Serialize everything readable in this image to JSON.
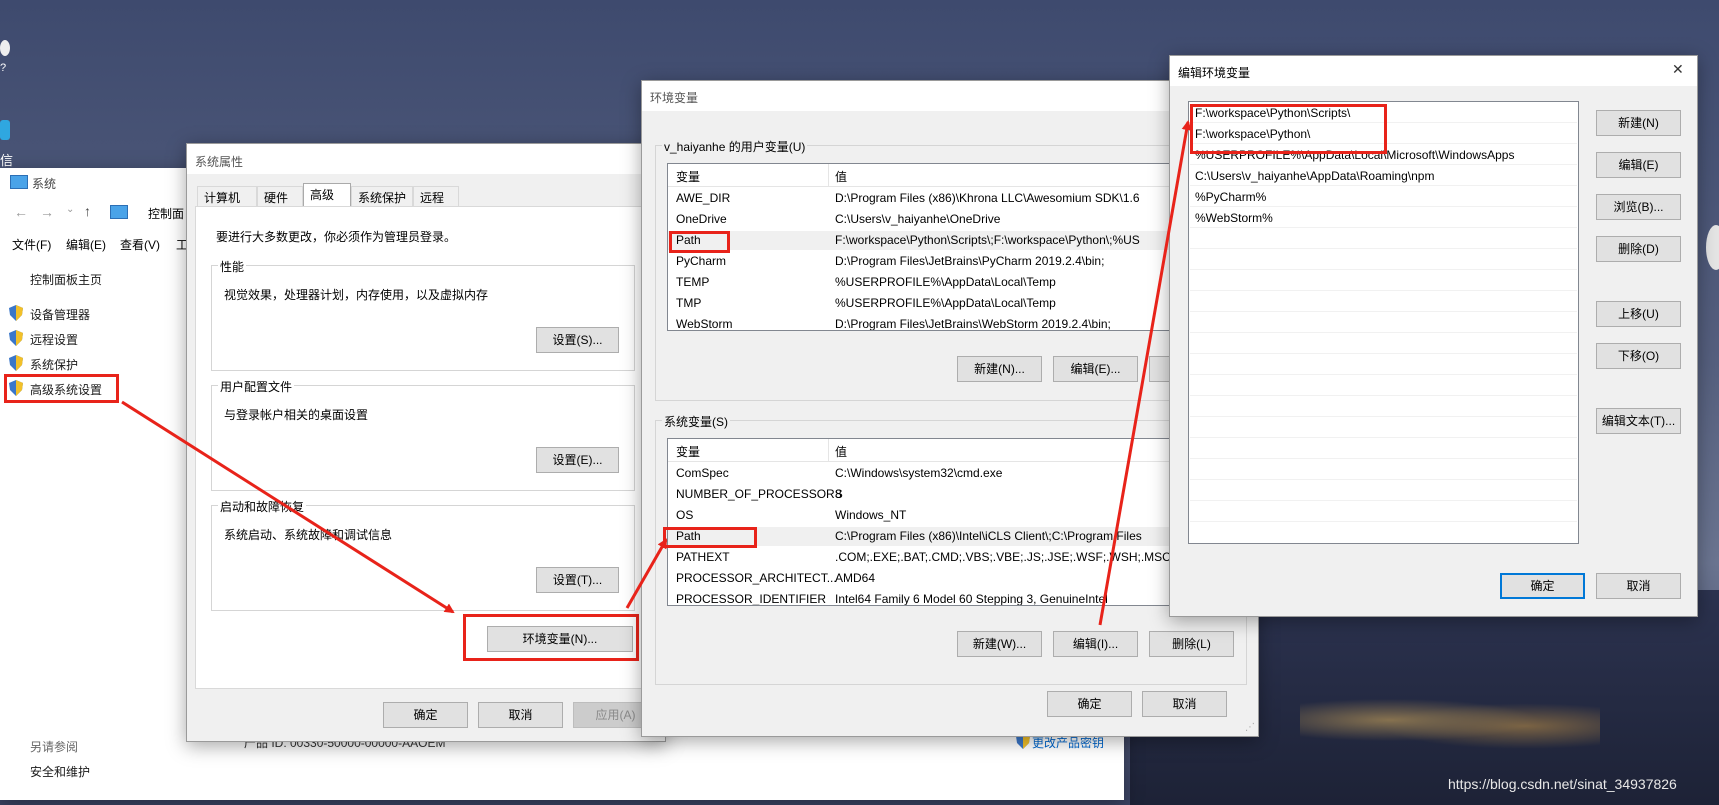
{
  "desktop": {
    "left_icon_label1": "?",
    "left_icon_label2": "信",
    "watermark": "https://blog.csdn.net/sinat_34937826"
  },
  "system_window": {
    "title": "系统",
    "address": "控制面",
    "menu": [
      "文件(F)",
      "编辑(E)",
      "查看(V)",
      "工"
    ],
    "nav_home": "控制面板主页",
    "links": [
      "设备管理器",
      "远程设置",
      "系统保护",
      "高级系统设置"
    ],
    "see_also": "另请参阅",
    "security": "安全和维护",
    "product_id": "产品 ID: 00330-50000-00000-AAOEM",
    "change_key": "更改产品密钥"
  },
  "sysprops": {
    "title": "系统属性",
    "tabs": [
      "计算机名",
      "硬件",
      "高级",
      "系统保护",
      "远程"
    ],
    "admin_note": "要进行大多数更改，你必须作为管理员登录。",
    "perf_label": "性能",
    "perf_desc": "视觉效果，处理器计划，内存使用，以及虚拟内存",
    "perf_btn": "设置(S)...",
    "profile_label": "用户配置文件",
    "profile_desc": "与登录帐户相关的桌面设置",
    "profile_btn": "设置(E)...",
    "startup_label": "启动和故障恢复",
    "startup_desc": "系统启动、系统故障和调试信息",
    "startup_btn": "设置(T)...",
    "env_btn": "环境变量(N)...",
    "ok": "确定",
    "cancel": "取消",
    "apply": "应用(A)"
  },
  "envvars": {
    "title": "环境变量",
    "user_group": "v_haiyanhe 的用户变量(U)",
    "col_var": "变量",
    "col_val": "值",
    "user_vars": [
      {
        "name": "AWE_DIR",
        "value": "D:\\Program Files (x86)\\Khrona LLC\\Awesomium SDK\\1.6"
      },
      {
        "name": "OneDrive",
        "value": "C:\\Users\\v_haiyanhe\\OneDrive"
      },
      {
        "name": "Path",
        "value": "F:\\workspace\\Python\\Scripts\\;F:\\workspace\\Python\\;%US"
      },
      {
        "name": "PyCharm",
        "value": "D:\\Program Files\\JetBrains\\PyCharm 2019.2.4\\bin;"
      },
      {
        "name": "TEMP",
        "value": "%USERPROFILE%\\AppData\\Local\\Temp"
      },
      {
        "name": "TMP",
        "value": "%USERPROFILE%\\AppData\\Local\\Temp"
      },
      {
        "name": "WebStorm",
        "value": "D:\\Program Files\\JetBrains\\WebStorm 2019.2.4\\bin;"
      }
    ],
    "user_new": "新建(N)...",
    "user_edit": "编辑(E)...",
    "sys_group": "系统变量(S)",
    "sys_vars": [
      {
        "name": "ComSpec",
        "value": "C:\\Windows\\system32\\cmd.exe"
      },
      {
        "name": "NUMBER_OF_PROCESSORS",
        "value": "8"
      },
      {
        "name": "OS",
        "value": "Windows_NT"
      },
      {
        "name": "Path",
        "value": "C:\\Program Files (x86)\\Intel\\iCLS Client\\;C:\\Program Files"
      },
      {
        "name": "PATHEXT",
        "value": ".COM;.EXE;.BAT;.CMD;.VBS;.VBE;.JS;.JSE;.WSF;.WSH;.MSC"
      },
      {
        "name": "PROCESSOR_ARCHITECT...",
        "value": "AMD64"
      },
      {
        "name": "PROCESSOR_IDENTIFIER",
        "value": "Intel64 Family 6 Model 60 Stepping 3, GenuineIntel"
      }
    ],
    "sys_new": "新建(W)...",
    "sys_edit": "编辑(I)...",
    "sys_delete": "删除(L)",
    "ok": "确定",
    "cancel": "取消"
  },
  "editenv": {
    "title": "编辑环境变量",
    "close": "✕",
    "items": [
      "F:\\workspace\\Python\\Scripts\\",
      "F:\\workspace\\Python\\",
      "%USERPROFILE%\\AppData\\Local\\Microsoft\\WindowsApps",
      "C:\\Users\\v_haiyanhe\\AppData\\Roaming\\npm",
      "%PyCharm%",
      "%WebStorm%"
    ],
    "btn_new": "新建(N)",
    "btn_edit": "编辑(E)",
    "btn_browse": "浏览(B)...",
    "btn_delete": "删除(D)",
    "btn_up": "上移(U)",
    "btn_down": "下移(O)",
    "btn_edit_text": "编辑文本(T)...",
    "ok": "确定",
    "cancel": "取消"
  },
  "colors": {
    "annotation_red": "#e8231a",
    "focus_blue": "#0078d7"
  }
}
